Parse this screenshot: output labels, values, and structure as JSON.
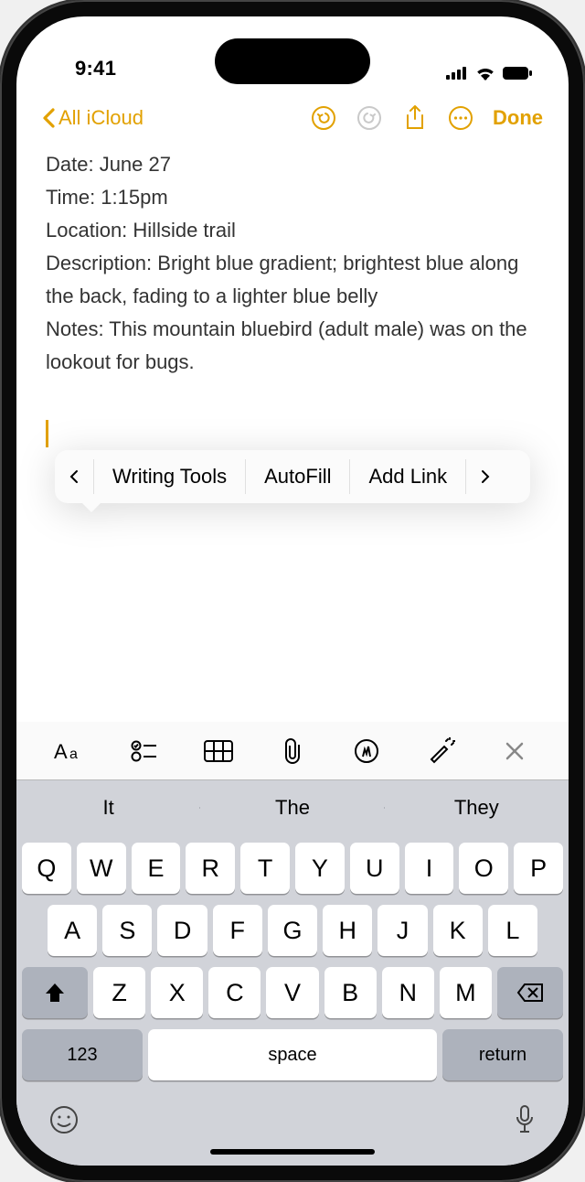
{
  "status": {
    "time": "9:41"
  },
  "nav": {
    "back_label": "All iCloud",
    "done_label": "Done"
  },
  "note": {
    "lines": [
      "Date: June 27",
      "Time: 1:15pm",
      "Location: Hillside trail",
      "Description: Bright blue gradient; brightest blue along the back, fading to a lighter blue belly",
      "Notes: This mountain bluebird (adult male) was on the lookout for bugs."
    ]
  },
  "context_menu": {
    "items": [
      "Writing Tools",
      "AutoFill",
      "Add Link"
    ],
    "highlighted": "Add Link"
  },
  "format_bar_icons": [
    "text-format",
    "checklist",
    "table",
    "attachment",
    "markup",
    "magic",
    "close"
  ],
  "suggestions": [
    "It",
    "The",
    "They"
  ],
  "keyboard": {
    "row1": [
      "Q",
      "W",
      "E",
      "R",
      "T",
      "Y",
      "U",
      "I",
      "O",
      "P"
    ],
    "row2": [
      "A",
      "S",
      "D",
      "F",
      "G",
      "H",
      "J",
      "K",
      "L"
    ],
    "row3": [
      "Z",
      "X",
      "C",
      "V",
      "B",
      "N",
      "M"
    ],
    "numbers_label": "123",
    "space_label": "space",
    "return_label": "return"
  }
}
